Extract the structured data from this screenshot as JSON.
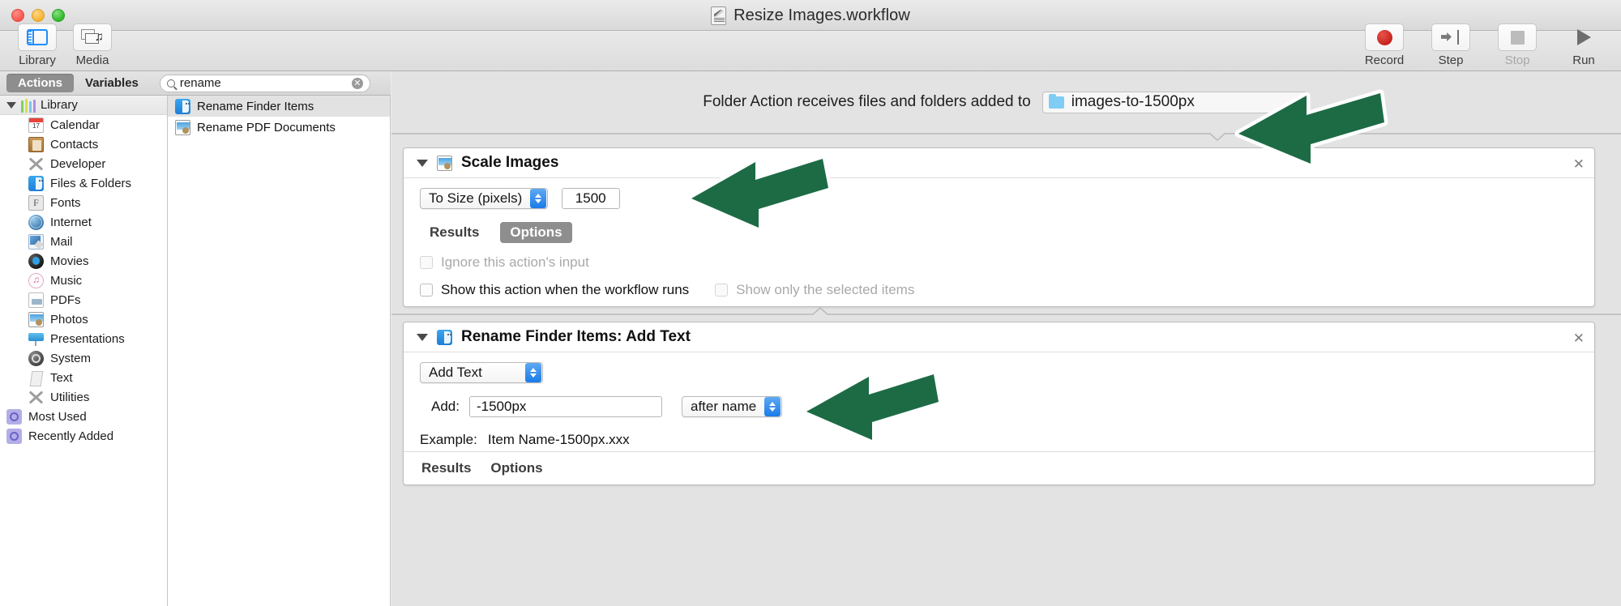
{
  "window": {
    "title": "Resize Images.workflow",
    "doc_icon": "automator-document-icon"
  },
  "toolbar": {
    "left": [
      {
        "label": "Library",
        "icon": "library-icon"
      },
      {
        "label": "Media",
        "icon": "media-icon"
      }
    ],
    "right": [
      {
        "label": "Record",
        "icon": "record-icon",
        "enabled": true
      },
      {
        "label": "Step",
        "icon": "step-icon",
        "enabled": true
      },
      {
        "label": "Stop",
        "icon": "stop-icon",
        "enabled": false
      },
      {
        "label": "Run",
        "icon": "run-icon",
        "enabled": true
      }
    ]
  },
  "filter_bar": {
    "segments": [
      {
        "label": "Actions",
        "selected": true
      },
      {
        "label": "Variables",
        "selected": false
      }
    ],
    "search": {
      "value": "rename",
      "placeholder": "Search",
      "icon": "search-icon",
      "clear_icon": "clear-icon"
    }
  },
  "sidebar": {
    "root": {
      "label": "Library",
      "icon": "books-icon",
      "expanded": true
    },
    "items": [
      {
        "label": "Calendar",
        "icon": "calendar-icon"
      },
      {
        "label": "Contacts",
        "icon": "contacts-icon"
      },
      {
        "label": "Developer",
        "icon": "developer-icon"
      },
      {
        "label": "Files & Folders",
        "icon": "finder-icon"
      },
      {
        "label": "Fonts",
        "icon": "fonts-icon"
      },
      {
        "label": "Internet",
        "icon": "internet-icon"
      },
      {
        "label": "Mail",
        "icon": "mail-icon"
      },
      {
        "label": "Movies",
        "icon": "movies-icon"
      },
      {
        "label": "Music",
        "icon": "music-icon"
      },
      {
        "label": "PDFs",
        "icon": "pdf-icon"
      },
      {
        "label": "Photos",
        "icon": "photos-icon"
      },
      {
        "label": "Presentations",
        "icon": "presentations-icon"
      },
      {
        "label": "System",
        "icon": "system-icon"
      },
      {
        "label": "Text",
        "icon": "text-icon"
      },
      {
        "label": "Utilities",
        "icon": "utilities-icon"
      }
    ],
    "smart_groups": [
      {
        "label": "Most Used",
        "icon": "smart-folder-icon"
      },
      {
        "label": "Recently Added",
        "icon": "smart-folder-icon"
      }
    ]
  },
  "action_list": {
    "rows": [
      {
        "label": "Rename Finder Items",
        "icon": "finder-icon",
        "selected": true
      },
      {
        "label": "Rename PDF Documents",
        "icon": "photos-icon",
        "selected": false
      }
    ]
  },
  "canvas": {
    "header": {
      "text": "Folder Action receives files and folders added to",
      "folder": {
        "name": "images-to-1500px",
        "icon": "folder-icon"
      }
    },
    "actions": [
      {
        "title": "Scale Images",
        "icon": "photos-icon",
        "close_icon": "close-icon",
        "size_mode": {
          "selected": "To Size (pixels)"
        },
        "size_value": "1500",
        "tabs": [
          {
            "label": "Results",
            "selected": false
          },
          {
            "label": "Options",
            "selected": true
          }
        ],
        "checkboxes": [
          {
            "label": "Ignore this action's input",
            "checked": false,
            "enabled": false
          },
          {
            "label": "Show this action when the workflow runs",
            "checked": false,
            "enabled": true
          },
          {
            "label": "Show only the selected items",
            "checked": false,
            "enabled": false
          }
        ]
      },
      {
        "title": "Rename Finder Items: Add Text",
        "icon": "finder-icon",
        "close_icon": "close-icon",
        "mode": {
          "selected": "Add Text"
        },
        "add_label": "Add:",
        "add_value": "-1500px",
        "position": {
          "selected": "after name"
        },
        "example_label": "Example:",
        "example_value": "Item Name-1500px.xxx",
        "tabs": [
          {
            "label": "Results",
            "selected": false
          },
          {
            "label": "Options",
            "selected": false
          }
        ]
      }
    ]
  },
  "annotations": {
    "arrow_color": "#1c6b45",
    "arrow_outline": "#ffffff",
    "arrows": [
      {
        "target": "folder-chip",
        "points_to": "images-to-1500px"
      },
      {
        "target": "scale-images-title",
        "points_to": "Scale Images"
      },
      {
        "target": "rename-finder-items-title",
        "points_to": "Rename Finder Items: Add Text"
      }
    ]
  }
}
